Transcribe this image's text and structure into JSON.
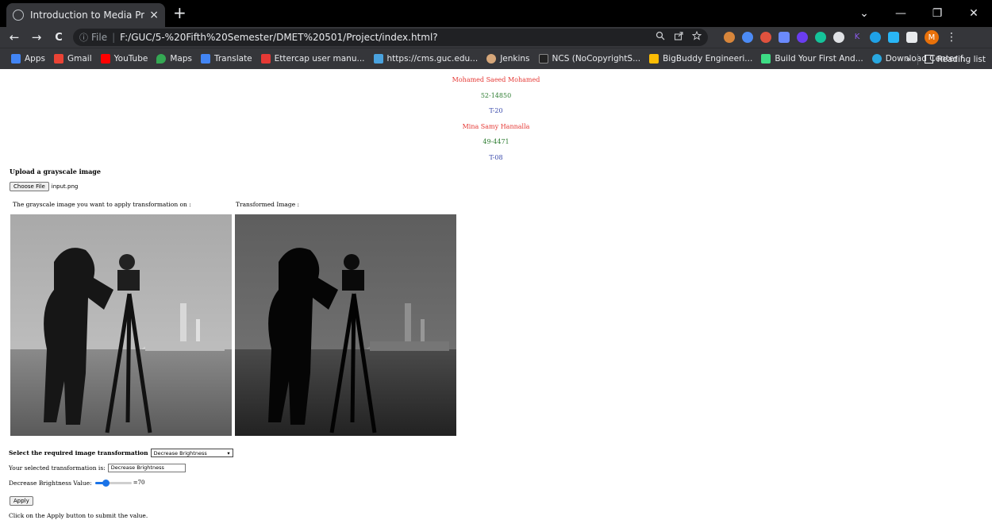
{
  "browser": {
    "tab_title": "Introduction to Media Project",
    "tab_close": "×",
    "new_tab": "+",
    "window_controls": {
      "dropdown": "⌄",
      "minimize": "—",
      "maximize": "❐",
      "close": "✕"
    },
    "nav": {
      "back": "←",
      "forward": "→",
      "reload": "C"
    },
    "address": {
      "info": "ⓘ",
      "scheme": "File",
      "separator": "|",
      "url": "F:/GUC/5-%20Fifth%20Semester/DMET%20501/Project/index.html?"
    },
    "omnibox_icons": [
      "zoom-icon",
      "share-icon",
      "star-icon"
    ],
    "extensions": [
      {
        "name": "cookie-extension-icon",
        "color": "#d8863b"
      },
      {
        "name": "blue-circle-extension-icon",
        "color": "#4c8bf5"
      },
      {
        "name": "red-extension-icon",
        "color": "#e0523e"
      },
      {
        "name": "camera-extension-icon",
        "color": "#6b8afd"
      },
      {
        "name": "purple-extension-icon",
        "color": "#6a3df0"
      },
      {
        "name": "grammarly-extension-icon",
        "color": "#15c39a"
      },
      {
        "name": "white-extension-icon",
        "color": "#dfe1e5"
      },
      {
        "name": "k-extension-icon",
        "color": "#8e5cf0"
      },
      {
        "name": "cyan-extension-icon",
        "color": "#1fa1e6"
      },
      {
        "name": "fox-extension-icon",
        "color": "#29b6f6"
      },
      {
        "name": "puzzle-extension-icon",
        "color": "#e8eaed"
      }
    ],
    "profile_initial": "M",
    "menu": "⋮",
    "bookmarks": [
      {
        "label": "Apps",
        "icon": "apps-grid-icon",
        "color": "#4285f4"
      },
      {
        "label": "Gmail",
        "icon": "gmail-icon",
        "color": "#ea4335"
      },
      {
        "label": "YouTube",
        "icon": "youtube-icon",
        "color": "#ff0000"
      },
      {
        "label": "Maps",
        "icon": "maps-icon",
        "color": "#34a853"
      },
      {
        "label": "Translate",
        "icon": "translate-icon",
        "color": "#4285f4"
      },
      {
        "label": "Ettercap user manu...",
        "icon": "checkmark-icon",
        "color": "#e53935"
      },
      {
        "label": "https://cms.guc.edu...",
        "icon": "document-icon",
        "color": "#4aa3df"
      },
      {
        "label": "Jenkins",
        "icon": "jenkins-icon",
        "color": "#d6a77a"
      },
      {
        "label": "NCS (NoCopyrightS...",
        "icon": "ncs-icon",
        "color": "#222222"
      },
      {
        "label": "BigBuddy Engineeri...",
        "icon": "drive-icon",
        "color": "#fbbc04"
      },
      {
        "label": "Build Your First And...",
        "icon": "android-icon",
        "color": "#3ddc84"
      },
      {
        "label": "Download Center f...",
        "icon": "download-center-icon",
        "color": "#29a8e0"
      }
    ],
    "bookmarks_overflow": "»",
    "reading_list": "Reading list"
  },
  "page": {
    "credits": [
      {
        "text": "Mohamed Saeed Mohamed",
        "color": "red"
      },
      {
        "text": "52-14850",
        "color": "green"
      },
      {
        "text": "T-20",
        "color": "blue"
      },
      {
        "text": "Mina Samy Hannalla",
        "color": "red"
      },
      {
        "text": "49-4471",
        "color": "green"
      },
      {
        "text": "T-08",
        "color": "blue"
      }
    ],
    "upload_title": "Upload a grayscale image",
    "choose_file_label": "Choose File",
    "file_name": "input.png",
    "caption_original": "The grayscale image you want to apply transformation on :",
    "caption_transformed": "Transformed Image :",
    "select_label": "Select the required image transformation",
    "select_value": "Decrease Brightness",
    "selected_label": "Your selected transformation is:",
    "selected_value": "Decrease Brightness",
    "brightness_label": "Decrease Brightness Value:",
    "brightness_value": 70,
    "brightness_max": 255,
    "brightness_display": "=70",
    "apply_label": "Apply",
    "hint": "Click on the Apply button to submit the value."
  }
}
